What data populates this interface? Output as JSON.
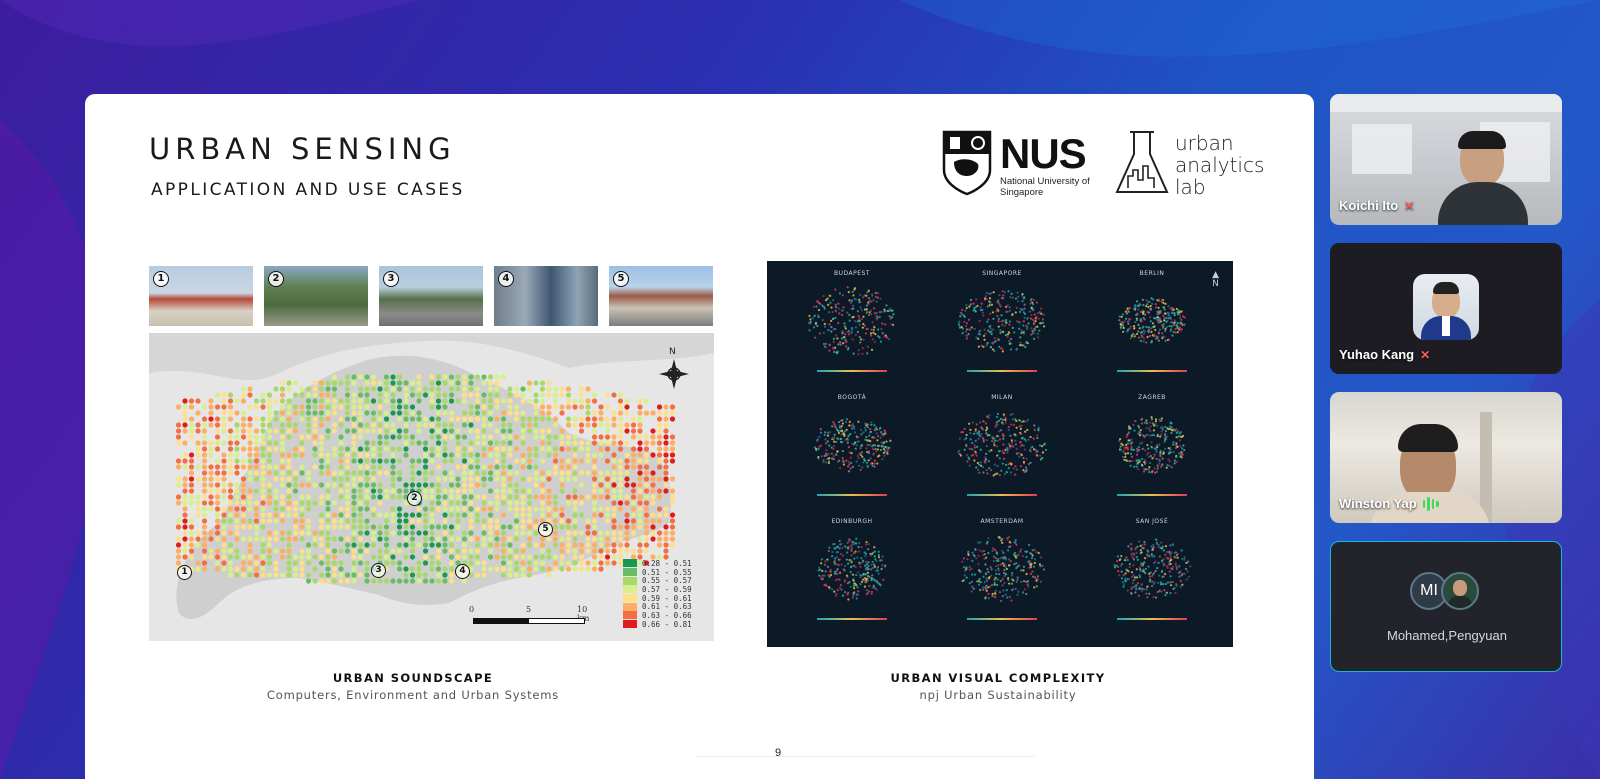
{
  "slide": {
    "title": "URBAN SENSING",
    "subtitle": "APPLICATION AND USE CASES",
    "logos": {
      "nus_word": "NUS",
      "nus_subtitle": "National University of Singapore",
      "lab_name": "urban analytics lab"
    },
    "soundscape": {
      "thumbnail_numbers": [
        "1",
        "2",
        "3",
        "4",
        "5"
      ],
      "map_markers": [
        "1",
        "2",
        "3",
        "4",
        "5"
      ],
      "north_label": "N",
      "legend": [
        {
          "range": "0.28 - 0.51",
          "color": "#1a9850"
        },
        {
          "range": "0.51 - 0.55",
          "color": "#66bd63"
        },
        {
          "range": "0.55 - 0.57",
          "color": "#a6d96a"
        },
        {
          "range": "0.57 - 0.59",
          "color": "#d9ef8b"
        },
        {
          "range": "0.59 - 0.61",
          "color": "#fee08b"
        },
        {
          "range": "0.61 - 0.63",
          "color": "#fdae61"
        },
        {
          "range": "0.63 - 0.66",
          "color": "#f46d43"
        },
        {
          "range": "0.66 - 0.81",
          "color": "#e01b1b"
        }
      ],
      "scale_labels": [
        "0",
        "5",
        "10 km"
      ],
      "caption_title": "URBAN SOUNDSCAPE",
      "caption_source": "Computers, Environment and Urban Systems"
    },
    "complexity": {
      "cities": [
        "BUDAPEST",
        "SINGAPORE",
        "BERLIN",
        "BOGOTÁ",
        "MILAN",
        "ZAGREB",
        "EDINBURGH",
        "AMSTERDAM",
        "SAN JOSÉ"
      ],
      "north_label": "N",
      "caption_title": "URBAN VISUAL COMPLEXITY",
      "caption_source": "npj Urban Sustainability"
    },
    "page_number": "9"
  },
  "participants": [
    {
      "name": "Koichi Ito",
      "status": "muted"
    },
    {
      "name": "Yuhao Kang",
      "status": "muted"
    },
    {
      "name": "Winston Yap",
      "status": "speaking"
    },
    {
      "name": "Mohamed,Pengyuan",
      "initials": "MI",
      "status": "grouped"
    }
  ],
  "colors": {
    "background_start": "#3c1d9e",
    "background_end": "#2457c8",
    "tile_dark": "#1c1c22",
    "active_border": "#19b8d6",
    "mic_off": "#ff5a5a",
    "speaking": "#3ddc5a"
  }
}
